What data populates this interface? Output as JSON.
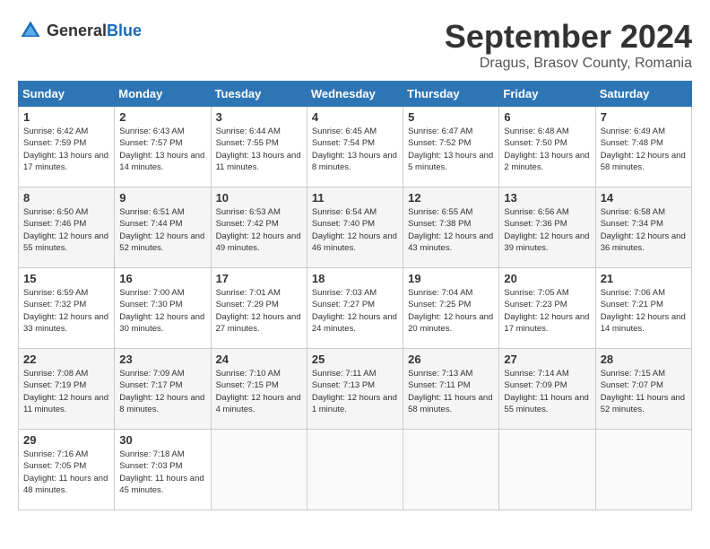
{
  "header": {
    "logo_general": "General",
    "logo_blue": "Blue",
    "title": "September 2024",
    "location": "Dragus, Brasov County, Romania"
  },
  "calendar": {
    "weekdays": [
      "Sunday",
      "Monday",
      "Tuesday",
      "Wednesday",
      "Thursday",
      "Friday",
      "Saturday"
    ],
    "rows": [
      [
        {
          "day": "1",
          "sunrise": "6:42 AM",
          "sunset": "7:59 PM",
          "daylight": "13 hours and 17 minutes."
        },
        {
          "day": "2",
          "sunrise": "6:43 AM",
          "sunset": "7:57 PM",
          "daylight": "13 hours and 14 minutes."
        },
        {
          "day": "3",
          "sunrise": "6:44 AM",
          "sunset": "7:55 PM",
          "daylight": "13 hours and 11 minutes."
        },
        {
          "day": "4",
          "sunrise": "6:45 AM",
          "sunset": "7:54 PM",
          "daylight": "13 hours and 8 minutes."
        },
        {
          "day": "5",
          "sunrise": "6:47 AM",
          "sunset": "7:52 PM",
          "daylight": "13 hours and 5 minutes."
        },
        {
          "day": "6",
          "sunrise": "6:48 AM",
          "sunset": "7:50 PM",
          "daylight": "13 hours and 2 minutes."
        },
        {
          "day": "7",
          "sunrise": "6:49 AM",
          "sunset": "7:48 PM",
          "daylight": "12 hours and 58 minutes."
        }
      ],
      [
        {
          "day": "8",
          "sunrise": "6:50 AM",
          "sunset": "7:46 PM",
          "daylight": "12 hours and 55 minutes."
        },
        {
          "day": "9",
          "sunrise": "6:51 AM",
          "sunset": "7:44 PM",
          "daylight": "12 hours and 52 minutes."
        },
        {
          "day": "10",
          "sunrise": "6:53 AM",
          "sunset": "7:42 PM",
          "daylight": "12 hours and 49 minutes."
        },
        {
          "day": "11",
          "sunrise": "6:54 AM",
          "sunset": "7:40 PM",
          "daylight": "12 hours and 46 minutes."
        },
        {
          "day": "12",
          "sunrise": "6:55 AM",
          "sunset": "7:38 PM",
          "daylight": "12 hours and 43 minutes."
        },
        {
          "day": "13",
          "sunrise": "6:56 AM",
          "sunset": "7:36 PM",
          "daylight": "12 hours and 39 minutes."
        },
        {
          "day": "14",
          "sunrise": "6:58 AM",
          "sunset": "7:34 PM",
          "daylight": "12 hours and 36 minutes."
        }
      ],
      [
        {
          "day": "15",
          "sunrise": "6:59 AM",
          "sunset": "7:32 PM",
          "daylight": "12 hours and 33 minutes."
        },
        {
          "day": "16",
          "sunrise": "7:00 AM",
          "sunset": "7:30 PM",
          "daylight": "12 hours and 30 minutes."
        },
        {
          "day": "17",
          "sunrise": "7:01 AM",
          "sunset": "7:29 PM",
          "daylight": "12 hours and 27 minutes."
        },
        {
          "day": "18",
          "sunrise": "7:03 AM",
          "sunset": "7:27 PM",
          "daylight": "12 hours and 24 minutes."
        },
        {
          "day": "19",
          "sunrise": "7:04 AM",
          "sunset": "7:25 PM",
          "daylight": "12 hours and 20 minutes."
        },
        {
          "day": "20",
          "sunrise": "7:05 AM",
          "sunset": "7:23 PM",
          "daylight": "12 hours and 17 minutes."
        },
        {
          "day": "21",
          "sunrise": "7:06 AM",
          "sunset": "7:21 PM",
          "daylight": "12 hours and 14 minutes."
        }
      ],
      [
        {
          "day": "22",
          "sunrise": "7:08 AM",
          "sunset": "7:19 PM",
          "daylight": "12 hours and 11 minutes."
        },
        {
          "day": "23",
          "sunrise": "7:09 AM",
          "sunset": "7:17 PM",
          "daylight": "12 hours and 8 minutes."
        },
        {
          "day": "24",
          "sunrise": "7:10 AM",
          "sunset": "7:15 PM",
          "daylight": "12 hours and 4 minutes."
        },
        {
          "day": "25",
          "sunrise": "7:11 AM",
          "sunset": "7:13 PM",
          "daylight": "12 hours and 1 minute."
        },
        {
          "day": "26",
          "sunrise": "7:13 AM",
          "sunset": "7:11 PM",
          "daylight": "11 hours and 58 minutes."
        },
        {
          "day": "27",
          "sunrise": "7:14 AM",
          "sunset": "7:09 PM",
          "daylight": "11 hours and 55 minutes."
        },
        {
          "day": "28",
          "sunrise": "7:15 AM",
          "sunset": "7:07 PM",
          "daylight": "11 hours and 52 minutes."
        }
      ],
      [
        {
          "day": "29",
          "sunrise": "7:16 AM",
          "sunset": "7:05 PM",
          "daylight": "11 hours and 48 minutes."
        },
        {
          "day": "30",
          "sunrise": "7:18 AM",
          "sunset": "7:03 PM",
          "daylight": "11 hours and 45 minutes."
        },
        {
          "day": "",
          "sunrise": "",
          "sunset": "",
          "daylight": ""
        },
        {
          "day": "",
          "sunrise": "",
          "sunset": "",
          "daylight": ""
        },
        {
          "day": "",
          "sunrise": "",
          "sunset": "",
          "daylight": ""
        },
        {
          "day": "",
          "sunrise": "",
          "sunset": "",
          "daylight": ""
        },
        {
          "day": "",
          "sunrise": "",
          "sunset": "",
          "daylight": ""
        }
      ]
    ]
  }
}
